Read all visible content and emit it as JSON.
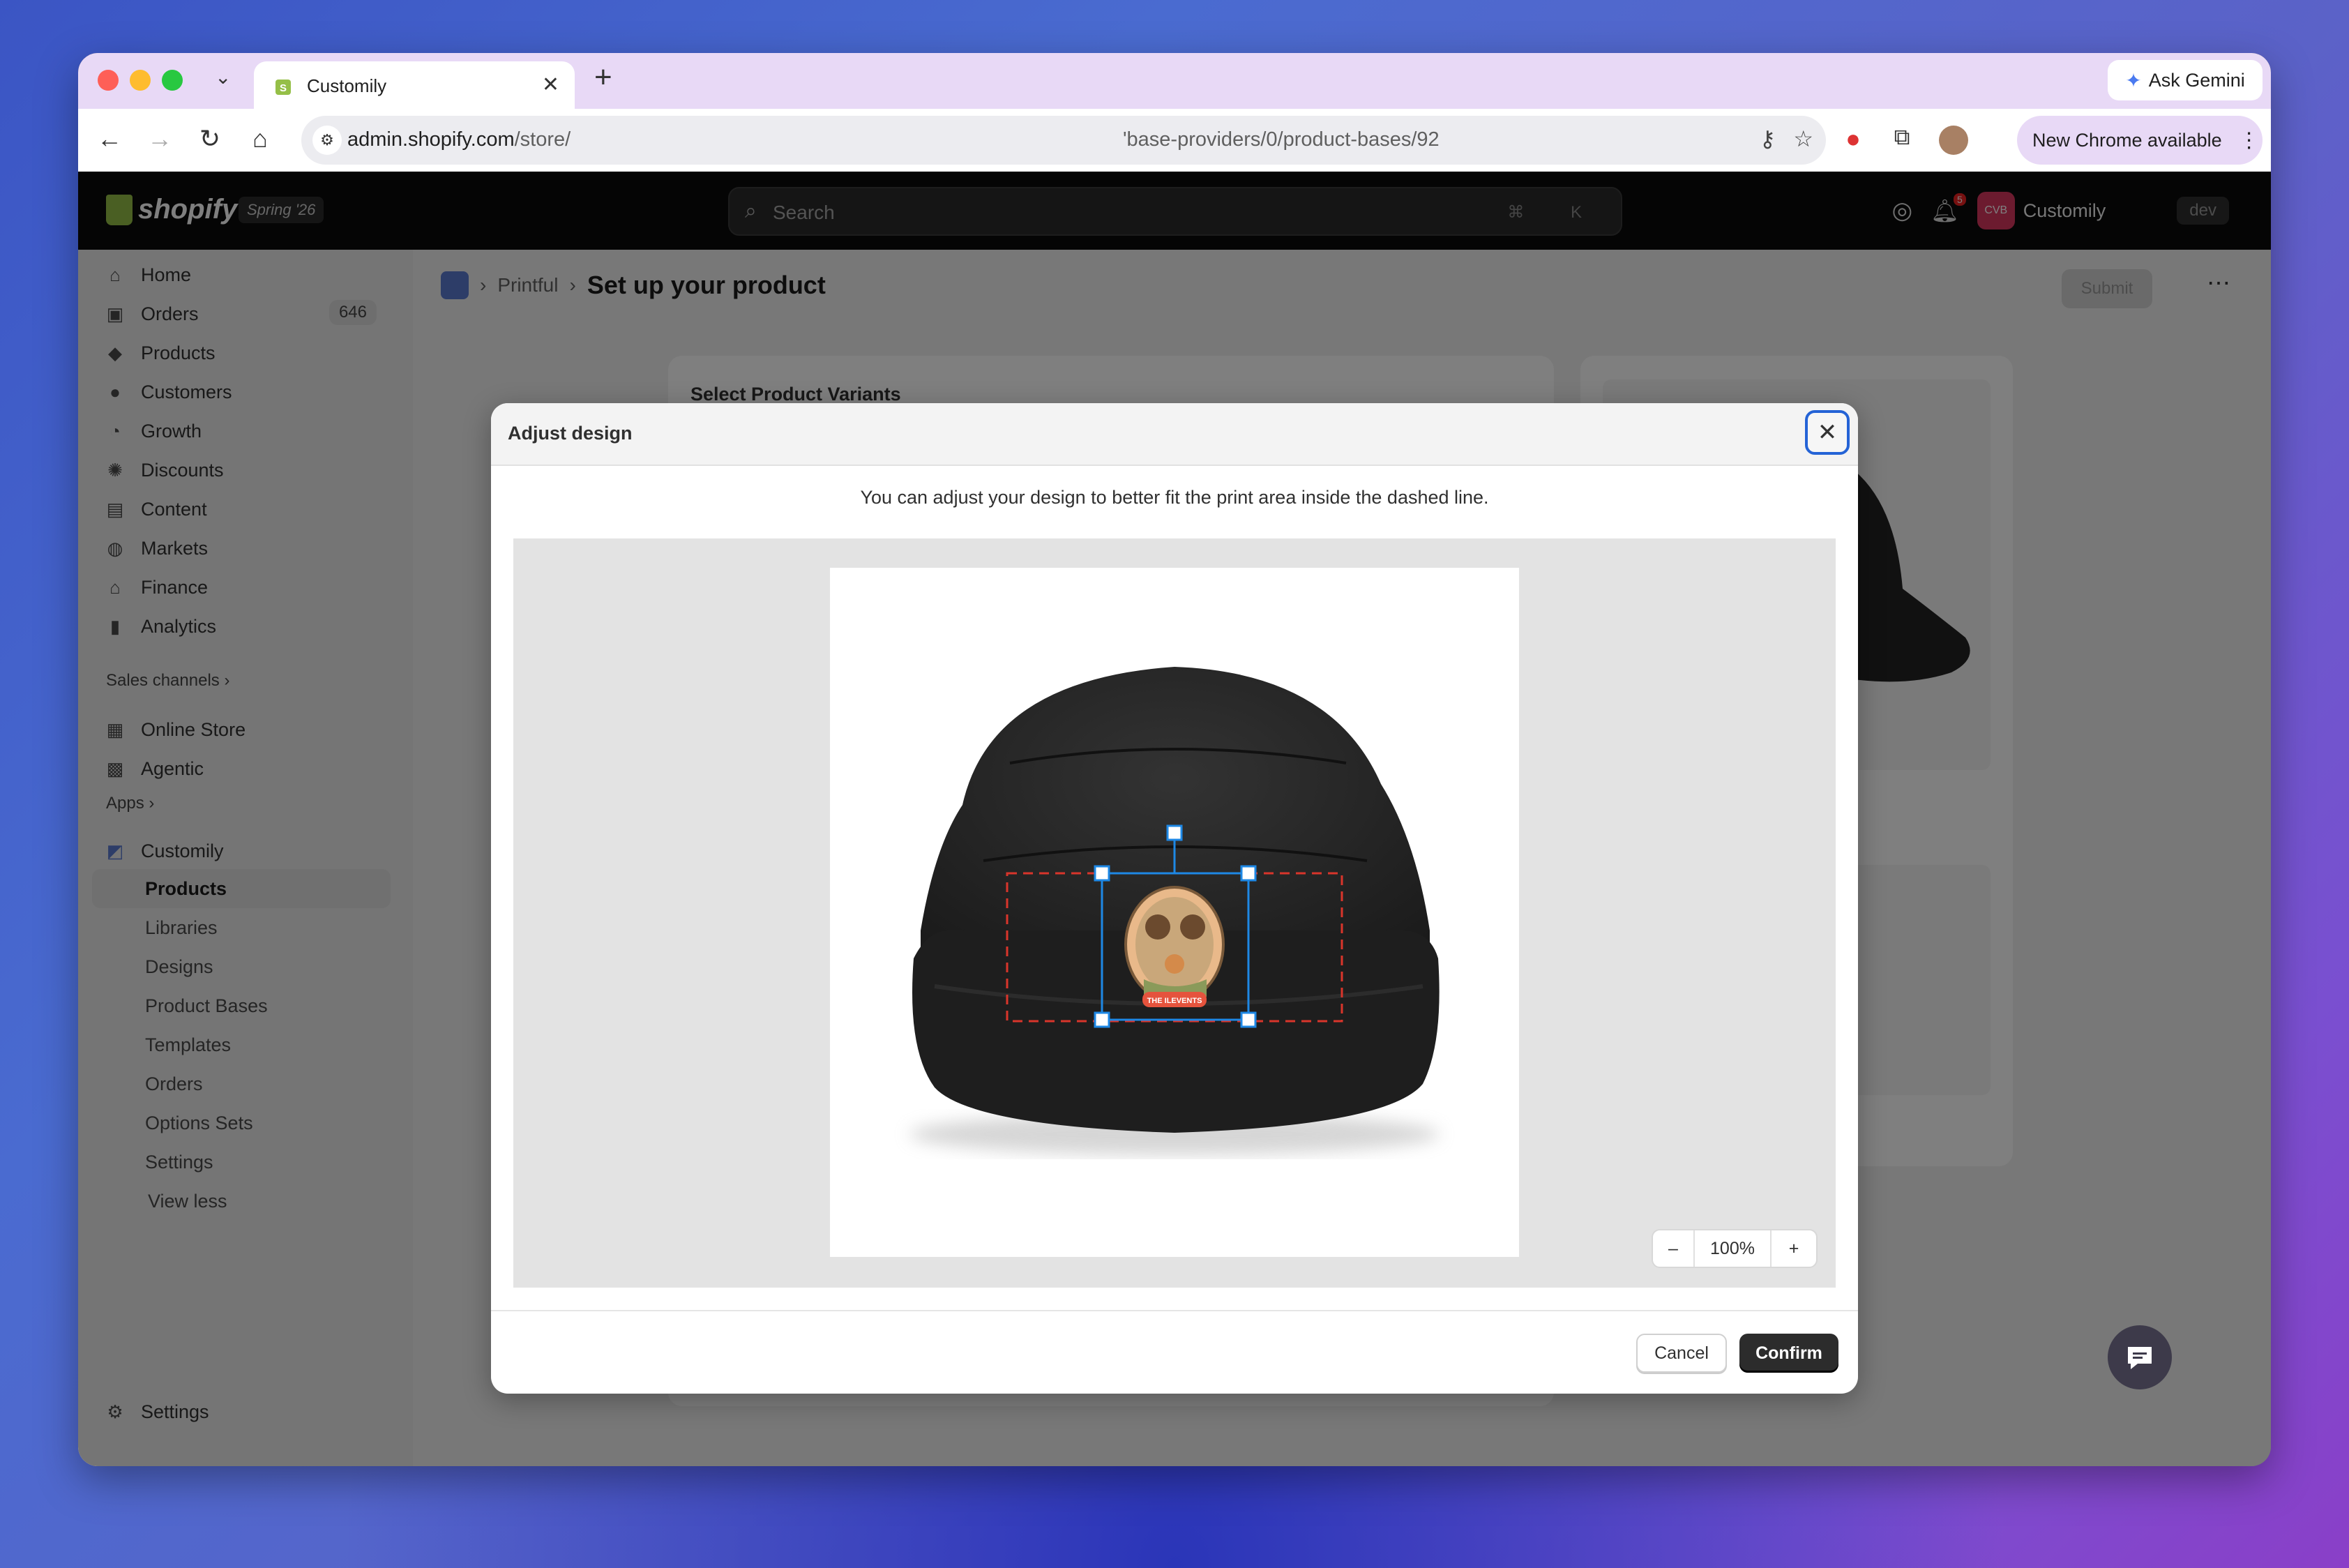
{
  "browser": {
    "tab_title": "Customily",
    "ask_gemini": "Ask Gemini",
    "url_host": "admin.shopify.com",
    "url_path": "/store/",
    "url_tail": "'base-providers/0/product-bases/92",
    "new_chrome": "New Chrome available"
  },
  "shopify": {
    "brand": "shopify",
    "edition": "Spring '26",
    "search_placeholder": "Search",
    "search_shortcut": "⌘ K",
    "notification_count": "5",
    "store_initials": "CVB",
    "store_name": "Customily",
    "env_badge": "dev"
  },
  "sidebar": {
    "items": [
      {
        "label": "Home",
        "icon": "home-icon"
      },
      {
        "label": "Orders",
        "icon": "orders-icon",
        "count": "646"
      },
      {
        "label": "Products",
        "icon": "tag-icon"
      },
      {
        "label": "Customers",
        "icon": "person-icon"
      },
      {
        "label": "Growth",
        "icon": "growth-icon"
      },
      {
        "label": "Discounts",
        "icon": "discount-icon"
      },
      {
        "label": "Content",
        "icon": "content-icon"
      },
      {
        "label": "Markets",
        "icon": "globe-icon"
      },
      {
        "label": "Finance",
        "icon": "bank-icon"
      },
      {
        "label": "Analytics",
        "icon": "chart-icon"
      }
    ],
    "sales_channels_label": "Sales channels",
    "channels": [
      "Online Store",
      "Agentic"
    ],
    "apps_label": "Apps",
    "app_name": "Customily",
    "app_subitems": [
      "Products",
      "Libraries",
      "Designs",
      "Product Bases",
      "Templates",
      "Orders",
      "Options Sets",
      "Settings",
      "View less"
    ],
    "settings_label": "Settings"
  },
  "main": {
    "breadcrumb_parent": "Printful",
    "page_title": "Set up your product",
    "submit_label": "Submit",
    "card_heading": "Select Product Variants"
  },
  "modal": {
    "title": "Adjust design",
    "instruction": "You can adjust your design to better fit the print area inside the dashed line.",
    "zoom_level": "100%",
    "zoom_out": "–",
    "zoom_in": "+",
    "design_caption": "THE ILEVENTS",
    "cancel_label": "Cancel",
    "confirm_label": "Confirm"
  },
  "colors": {
    "accent_focus": "#2463d6",
    "primary_button": "#2c2c2c",
    "print_area_dashes": "#d9352b",
    "selection_box": "#1e88e5"
  }
}
